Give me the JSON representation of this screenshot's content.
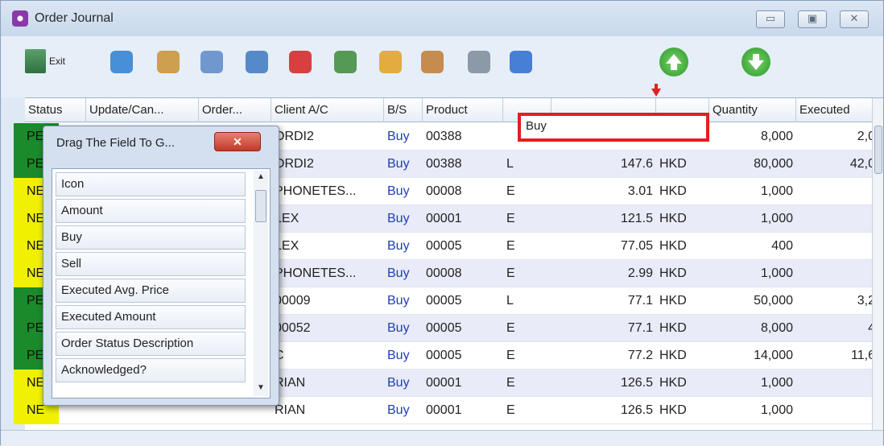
{
  "window": {
    "title": "Order Journal",
    "minimize": "▭",
    "restore": "▣",
    "close": "✕"
  },
  "toolbar": {
    "exit_label": "Exit",
    "buttons": [
      {
        "name": "globe-icon",
        "color": "#2a7ed0"
      },
      {
        "name": "folder-icon",
        "color": "#c99030"
      },
      {
        "name": "book-icon",
        "color": "#5a88c8"
      },
      {
        "name": "edit-icon",
        "color": "#3a78c0"
      },
      {
        "name": "delete-icon",
        "color": "#d42020"
      },
      {
        "name": "approve-icon",
        "color": "#3a8a3a"
      },
      {
        "name": "clipboard-icon",
        "color": "#e0a020"
      },
      {
        "name": "user-icon",
        "color": "#c07a30"
      },
      {
        "name": "search-icon",
        "color": "#7a8a9a"
      },
      {
        "name": "refresh-icon",
        "color": "#2a6ad0"
      }
    ],
    "up_arrow_icon": "up-arrow-icon",
    "down_arrow_icon": "down-arrow-icon"
  },
  "grid": {
    "columns": [
      "Status",
      "Update/Can...",
      "Order...",
      "Client A/C",
      "B/S",
      "Product",
      "",
      "",
      "",
      "Quantity",
      "Executed"
    ],
    "rows": [
      {
        "status": "PE",
        "status_color": "#1a8a2a",
        "client": "ORDI2",
        "bs": "Buy",
        "product": "00388",
        "type": "",
        "price": "",
        "ccy": "",
        "qty": "8,000",
        "exec": "2,0"
      },
      {
        "status": "PE",
        "status_color": "#1a8a2a",
        "client": "ORDI2",
        "bs": "Buy",
        "product": "00388",
        "type": "L",
        "price": "147.6",
        "ccy": "HKD",
        "qty": "80,000",
        "exec": "42,0"
      },
      {
        "status": "NE",
        "status_color": "#f0f000",
        "client": "PHONETES...",
        "bs": "Buy",
        "product": "00008",
        "type": "E",
        "price": "3.01",
        "ccy": "HKD",
        "qty": "1,000",
        "exec": ""
      },
      {
        "status": "NE",
        "status_color": "#f0f000",
        "client": "LEX",
        "bs": "Buy",
        "product": "00001",
        "type": "E",
        "price": "121.5",
        "ccy": "HKD",
        "qty": "1,000",
        "exec": ""
      },
      {
        "status": "NE",
        "status_color": "#f0f000",
        "client": "LEX",
        "bs": "Buy",
        "product": "00005",
        "type": "E",
        "price": "77.05",
        "ccy": "HKD",
        "qty": "400",
        "exec": ""
      },
      {
        "status": "NE",
        "status_color": "#f0f000",
        "client": "PHONETES...",
        "bs": "Buy",
        "product": "00008",
        "type": "E",
        "price": "2.99",
        "ccy": "HKD",
        "qty": "1,000",
        "exec": ""
      },
      {
        "status": "PE",
        "status_color": "#1a8a2a",
        "client": "00009",
        "bs": "Buy",
        "product": "00005",
        "type": "L",
        "price": "77.1",
        "ccy": "HKD",
        "qty": "50,000",
        "exec": "3,2"
      },
      {
        "status": "PE",
        "status_color": "#1a8a2a",
        "client": "00052",
        "bs": "Buy",
        "product": "00005",
        "type": "E",
        "price": "77.1",
        "ccy": "HKD",
        "qty": "8,000",
        "exec": "4"
      },
      {
        "status": "PE",
        "status_color": "#1a8a2a",
        "client": "C",
        "bs": "Buy",
        "product": "00005",
        "type": "E",
        "price": "77.2",
        "ccy": "HKD",
        "qty": "14,000",
        "exec": "11,6"
      },
      {
        "status": "NE",
        "status_color": "#f0f000",
        "client": "RIAN",
        "bs": "Buy",
        "product": "00001",
        "type": "E",
        "price": "126.5",
        "ccy": "HKD",
        "qty": "1,000",
        "exec": ""
      },
      {
        "status": "NE",
        "status_color": "#f0f000",
        "client": "RIAN",
        "bs": "Buy",
        "product": "00001",
        "type": "E",
        "price": "126.5",
        "ccy": "HKD",
        "qty": "1,000",
        "exec": ""
      }
    ]
  },
  "drop_target": {
    "label": "Buy"
  },
  "popup": {
    "title": "Drag The Field To G...",
    "close": "✕",
    "items": [
      "Icon",
      "Amount",
      "Buy",
      "Sell",
      "Executed Avg. Price",
      "Executed Amount",
      "Order Status Description",
      "Acknowledged?"
    ]
  }
}
